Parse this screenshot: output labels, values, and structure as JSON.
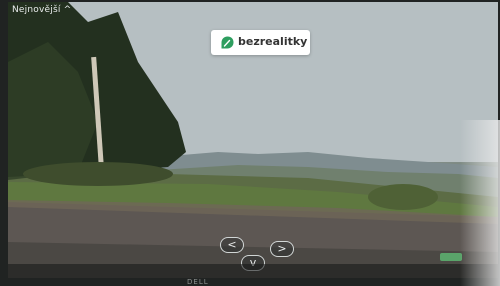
{
  "colors": {
    "brand_accent": "#2e9e5f",
    "overlay_text": "#e9ecec"
  },
  "header": {
    "sort_label": "Nejnovější ^"
  },
  "logo": {
    "text": "bezrealitky",
    "icon": "bezrealitky-leaf-icon"
  },
  "street_view": {
    "controls": [
      {
        "label": "<",
        "icon": "arrow-left-icon"
      },
      {
        "label": ">",
        "icon": "arrow-right-icon"
      },
      {
        "label": "v",
        "icon": "arrow-down-icon"
      }
    ]
  },
  "device": {
    "brand": "DELL"
  }
}
